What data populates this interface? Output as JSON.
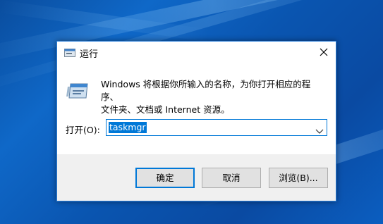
{
  "window": {
    "title": "运行",
    "close_icon": "close-icon"
  },
  "description": {
    "line1": "Windows 将根据你所输入的名称，为你打开相应的程序、",
    "line2": "文件夹、文档或 Internet 资源。"
  },
  "open_field": {
    "label": "打开(O):",
    "value": "taskmgr"
  },
  "buttons": {
    "ok": "确定",
    "cancel": "取消",
    "browse": "浏览(B)..."
  },
  "colors": {
    "accent": "#0078d7",
    "desktop": "#0a55b0"
  }
}
